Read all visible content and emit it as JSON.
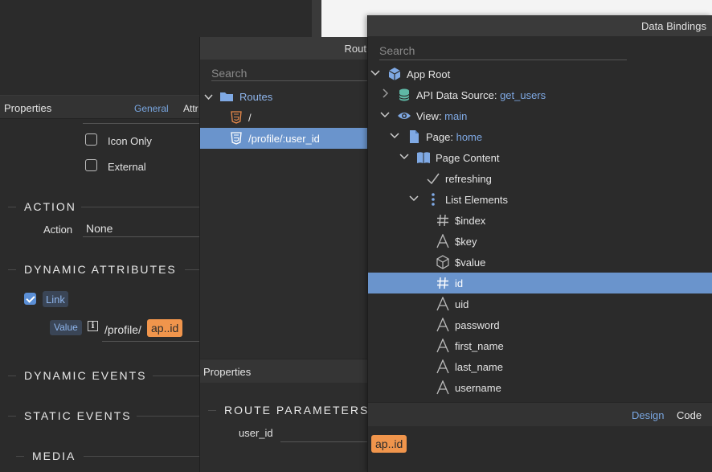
{
  "left_panel": {
    "title": "Properties",
    "tab_general": "General",
    "tab_attr": "Attr",
    "options": [
      {
        "label": "Icon Only",
        "checked": false
      },
      {
        "label": "External",
        "checked": false
      }
    ],
    "action_section": "ACTION",
    "action_label": "Action",
    "action_value": "None",
    "dynamic_attributes_section": "DYNAMIC ATTRIBUTES",
    "link_label": "Link",
    "link_checked": true,
    "value_label": "Value",
    "value_prefix": "/profile/",
    "value_token": "ap..id",
    "dynamic_events_section": "DYNAMIC EVENTS",
    "static_events_section": "STATIC EVENTS",
    "media_section": "MEDIA"
  },
  "routes_panel": {
    "title": "Rout",
    "search_placeholder": "Search",
    "routes_folder": "Routes",
    "items": [
      {
        "label": "/"
      },
      {
        "label": "/profile/:user_id",
        "selected": true
      }
    ],
    "properties_title": "Properties",
    "route_parameters_section": "ROUTE PARAMETERS",
    "param_label": "user_id"
  },
  "data_bindings": {
    "title": "Data Bindings",
    "search_placeholder": "Search",
    "tree": [
      {
        "label": "App Root",
        "value": "",
        "icon": "cube-icon",
        "chevron": "down"
      },
      {
        "label": "API Data Source: ",
        "value": "get_users",
        "icon": "database-icon",
        "chevron": "right"
      },
      {
        "label": "View: ",
        "value": "main",
        "icon": "eye-icon",
        "chevron": "down"
      },
      {
        "label": "Page: ",
        "value": "home",
        "icon": "page-icon",
        "chevron": "down"
      },
      {
        "label": "Page Content",
        "value": "",
        "icon": "book-icon",
        "chevron": "down"
      },
      {
        "label": "refreshing",
        "value": "",
        "icon": "check-icon",
        "chevron": ""
      },
      {
        "label": "List Elements",
        "value": "",
        "icon": "list-icon",
        "chevron": "down"
      },
      {
        "label": "$index",
        "value": "",
        "icon": "hash-icon",
        "chevron": ""
      },
      {
        "label": "$key",
        "value": "",
        "icon": "text-icon",
        "chevron": ""
      },
      {
        "label": "$value",
        "value": "",
        "icon": "box-icon",
        "chevron": ""
      },
      {
        "label": "id",
        "value": "",
        "icon": "hash-icon",
        "chevron": "",
        "selected": true
      },
      {
        "label": "uid",
        "value": "",
        "icon": "text-icon",
        "chevron": ""
      },
      {
        "label": "password",
        "value": "",
        "icon": "text-icon",
        "chevron": ""
      },
      {
        "label": "first_name",
        "value": "",
        "icon": "text-icon",
        "chevron": ""
      },
      {
        "label": "last_name",
        "value": "",
        "icon": "text-icon",
        "chevron": ""
      },
      {
        "label": "username",
        "value": "",
        "icon": "text-icon",
        "chevron": ""
      }
    ],
    "footer_design": "Design",
    "footer_code": "Code",
    "drag_token": "ap..id"
  },
  "colors": {
    "accent": "#79a6e0",
    "selection": "#6a94cc",
    "token": "#f0954c",
    "panel_bg": "#2b2b2b"
  }
}
